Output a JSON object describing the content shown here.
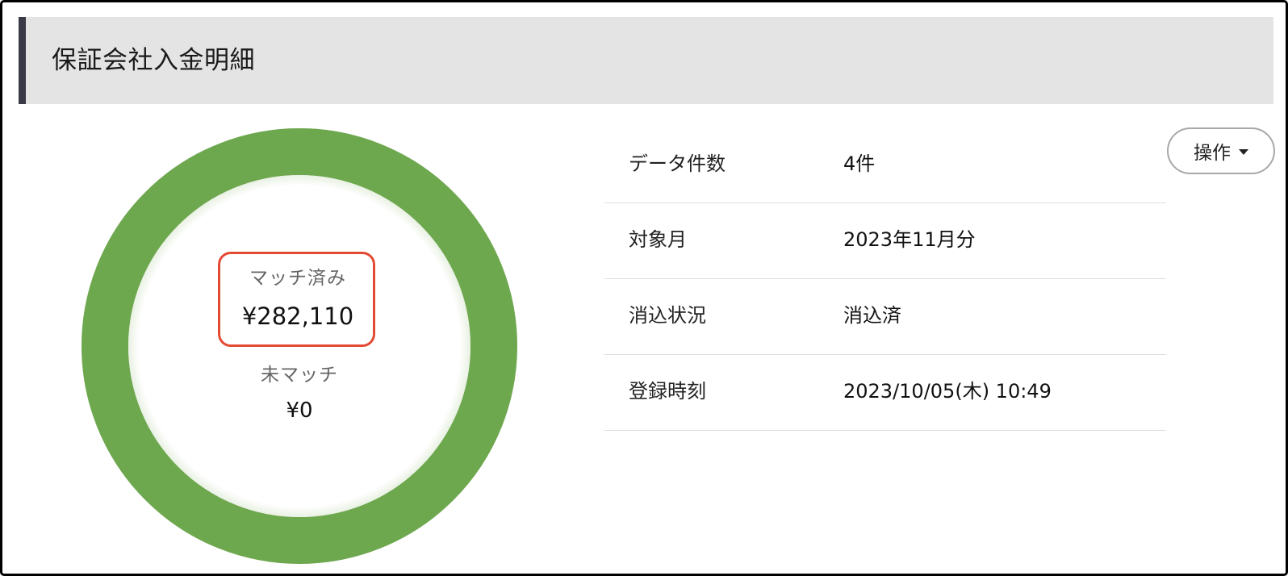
{
  "header": {
    "title": "保証会社入金明細"
  },
  "donut": {
    "matched_label": "マッチ済み",
    "matched_value": "¥282,110",
    "unmatched_label": "未マッチ",
    "unmatched_value": "¥0",
    "matched_fraction": 1.0,
    "matched_color": "#6ea84e",
    "unmatched_color": "#d9d9d9"
  },
  "info": {
    "rows": [
      {
        "label": "データ件数",
        "value": "4件"
      },
      {
        "label": "対象月",
        "value": "2023年11月分"
      },
      {
        "label": "消込状況",
        "value": "消込済"
      },
      {
        "label": "登録時刻",
        "value": "2023/10/05(木) 10:49"
      }
    ]
  },
  "actions": {
    "operation_label": "操作",
    "operation_icon": "caret-down-icon"
  },
  "colors": {
    "highlight_border": "#e34a33",
    "header_bar": "#3a3a46",
    "header_bg": "#e4e4e4"
  }
}
